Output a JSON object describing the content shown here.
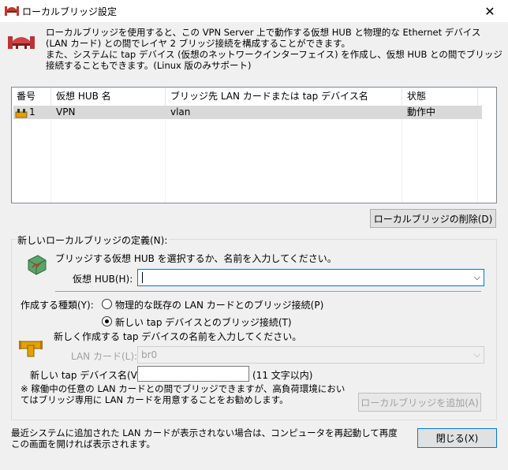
{
  "window": {
    "title": "ローカルブリッジ設定",
    "close_glyph": "✕"
  },
  "description": "ローカルブリッジを使用すると、この VPN Server 上で動作する仮想 HUB と物理的な Ethernet デバイス (LAN カード) との間でレイヤ 2 ブリッジ接続を構成することができます。\nまた、システムに tap デバイス (仮想のネットワークインターフェイス) を作成し、仮想 HUB との間でブリッジ接続することもできます。(Linux 版のみサポート)",
  "list": {
    "columns": [
      "番号",
      "仮想 HUB 名",
      "ブリッジ先 LAN カードまたは tap デバイス名",
      "状態"
    ],
    "rows": [
      {
        "num": "1",
        "hub": "VPN",
        "target": "vlan",
        "status": "動作中"
      }
    ]
  },
  "buttons": {
    "delete": "ローカルブリッジの削除(D)",
    "add": "ローカルブリッジを追加(A)",
    "close": "閉じる(X)"
  },
  "define_group": {
    "label": "新しいローカルブリッジの定義(N):",
    "hub_prompt": "ブリッジする仮想 HUB を選択するか、名前を入力してください。",
    "hub_label": "仮想 HUB(H):",
    "hub_value": "",
    "type_label": "作成する種類(Y):",
    "radio_physical": "物理的な既存の LAN カードとのブリッジ接続(P)",
    "radio_tap": "新しい tap デバイスとのブリッジ接続(T)",
    "tap_prompt": "新しく作成する tap デバイスの名前を入力してください。",
    "lan_label": "LAN カード(L):",
    "lan_value": "br0",
    "tap_label": "新しい tap デバイス名(V):",
    "tap_value": "",
    "tap_hint": "(11 文字以内)",
    "note": "※ 稼働中の任意の LAN カードとの間でブリッジできますが、高負荷環境においてはブリッジ専用に LAN カードを用意することをお勧めします。"
  },
  "footer_note": "最近システムに追加された LAN カードが表示されない場合は、コンピュータを再起動して再度この画面を開ければ表示されます。",
  "colors": {
    "accent": "#0078d7",
    "selected_row": "#d9d9d9",
    "dialog_bg": "#f0f0f0"
  }
}
